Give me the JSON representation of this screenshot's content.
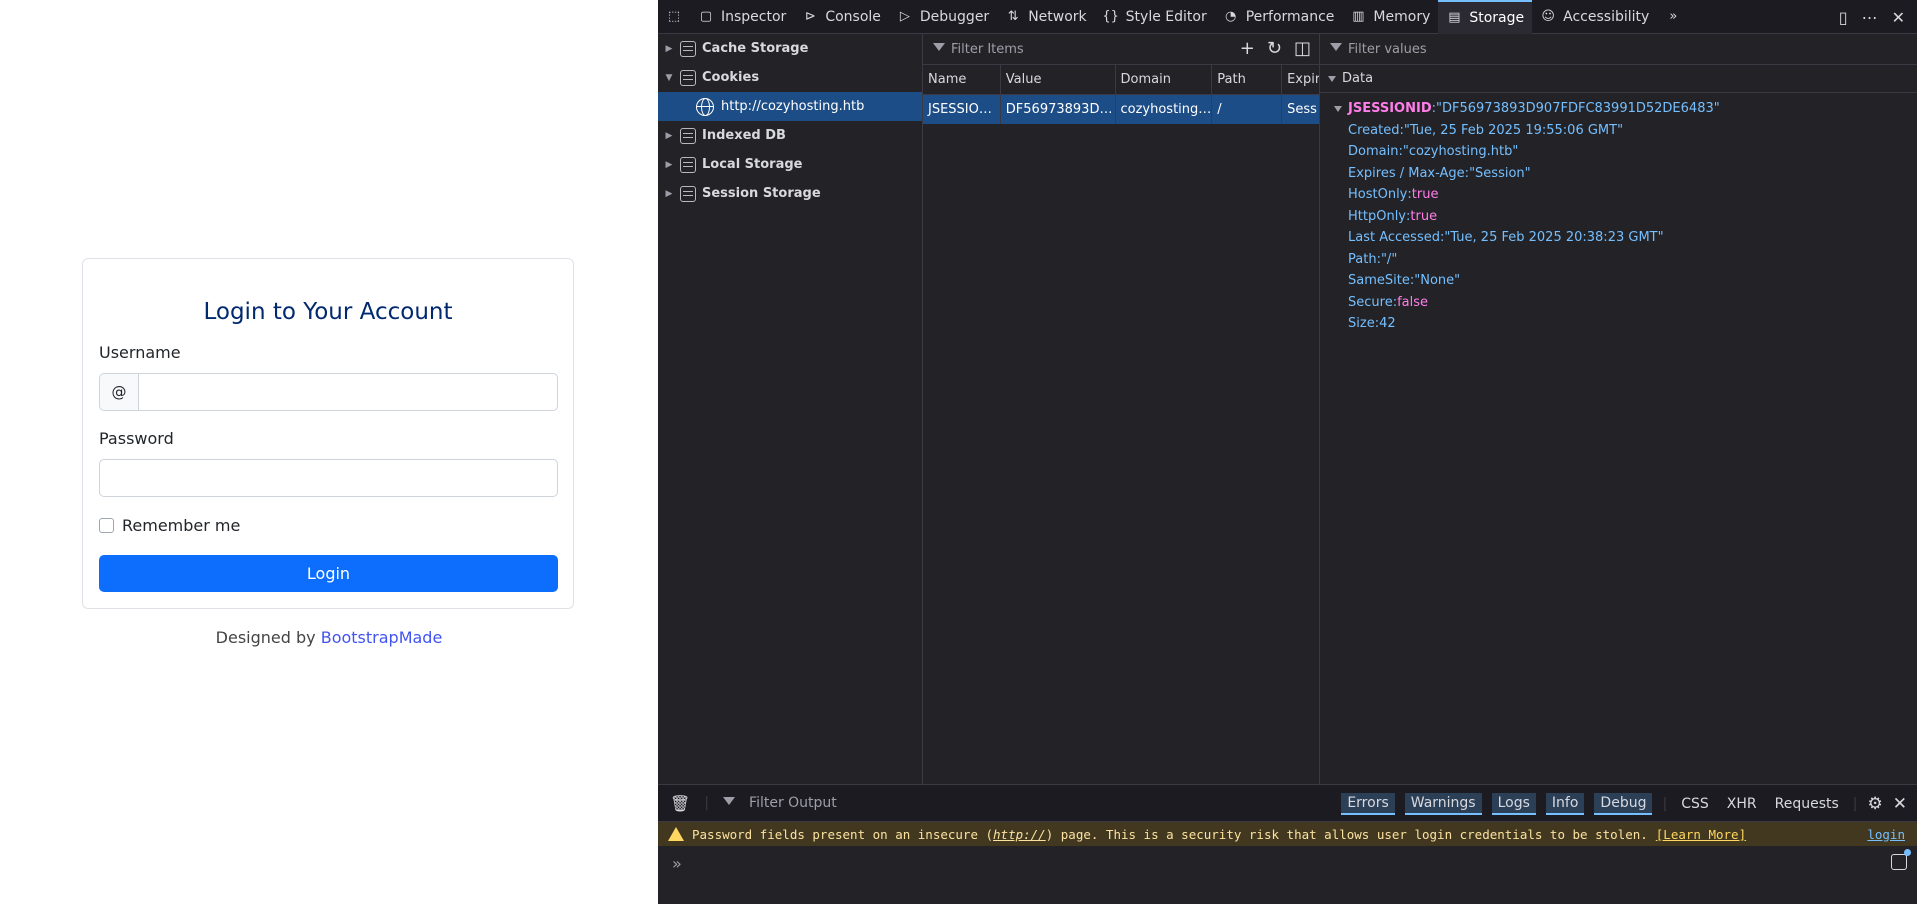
{
  "login": {
    "title": "Login to Your Account",
    "username_label": "Username",
    "at_sign": "@",
    "password_label": "Password",
    "remember_label": "Remember me",
    "login_button": "Login",
    "credits_prefix": "Designed by ",
    "credits_link": "BootstrapMade"
  },
  "devtools": {
    "tabs": [
      {
        "label": "Inspector",
        "icon": "inspector-icon"
      },
      {
        "label": "Console",
        "icon": "console-icon"
      },
      {
        "label": "Debugger",
        "icon": "debugger-icon"
      },
      {
        "label": "Network",
        "icon": "network-icon"
      },
      {
        "label": "Style Editor",
        "icon": "style-editor-icon"
      },
      {
        "label": "Performance",
        "icon": "performance-icon"
      },
      {
        "label": "Memory",
        "icon": "memory-icon"
      },
      {
        "label": "Storage",
        "icon": "storage-icon"
      },
      {
        "label": "Accessibility",
        "icon": "accessibility-icon"
      }
    ],
    "active_tab": "Storage",
    "tree": {
      "cache_storage": "Cache Storage",
      "cookies": "Cookies",
      "cookie_host": "http://cozyhosting.htb",
      "indexed_db": "Indexed DB",
      "local_storage": "Local Storage",
      "session_storage": "Session Storage"
    },
    "table": {
      "filter_placeholder": "Filter Items",
      "headers": [
        "Name",
        "Value",
        "Domain",
        "Path",
        "Expir"
      ],
      "row": [
        "JSESSIO…",
        "DF56973893D…",
        "cozyhosting…",
        "/",
        "Sess"
      ]
    },
    "sidebar": {
      "filter_placeholder": "Filter values",
      "data_label": "Data",
      "cookie_name": "JSESSIONID",
      "cookie_value": "\"DF56973893D907FDFC83991D52DE6483\"",
      "fields": [
        {
          "key": "Created",
          "value": "\"Tue, 25 Feb 2025 19:55:06 GMT\"",
          "kind": "str"
        },
        {
          "key": "Domain",
          "value": "\"cozyhosting.htb\"",
          "kind": "str"
        },
        {
          "key": "Expires / Max-Age",
          "value": "\"Session\"",
          "kind": "str"
        },
        {
          "key": "HostOnly",
          "value": "true",
          "kind": "bool"
        },
        {
          "key": "HttpOnly",
          "value": "true",
          "kind": "bool"
        },
        {
          "key": "Last Accessed",
          "value": "\"Tue, 25 Feb 2025 20:38:23 GMT\"",
          "kind": "str"
        },
        {
          "key": "Path",
          "value": "\"/\"",
          "kind": "str"
        },
        {
          "key": "SameSite",
          "value": "\"None\"",
          "kind": "str"
        },
        {
          "key": "Secure",
          "value": "false",
          "kind": "bool"
        },
        {
          "key": "Size",
          "value": "42",
          "kind": "str"
        }
      ]
    },
    "console": {
      "filter_placeholder": "Filter Output",
      "levels": [
        "Errors",
        "Warnings",
        "Logs",
        "Info",
        "Debug"
      ],
      "extra": [
        "CSS",
        "XHR",
        "Requests"
      ],
      "warning_text_pre": "Password fields present on an insecure (",
      "warning_text_em": "http://",
      "warning_text_post": ") page. This is a security risk that allows user login credentials to be stolen.",
      "learn_more": "[Learn More]",
      "source": "login",
      "prompt": "»"
    }
  }
}
